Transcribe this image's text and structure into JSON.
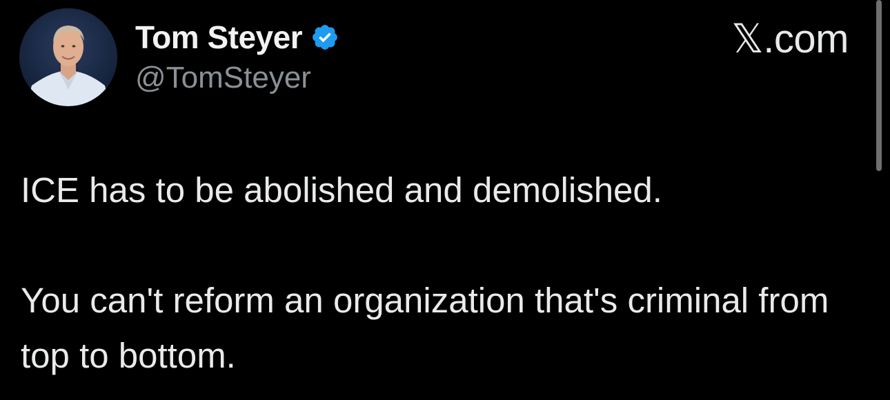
{
  "author": {
    "display_name": "Tom Steyer",
    "handle": "@TomSteyer",
    "verified_icon": "verified-badge-icon",
    "avatar_icon": "profile-photo"
  },
  "header": {
    "site_label": "𝕏.com"
  },
  "tweet": {
    "paragraphs": [
      "ICE has to be abolished and demolished.",
      "You can't reform an organization that's criminal from top to bottom."
    ]
  },
  "colors": {
    "background": "#000000",
    "text_primary": "#e7e9ea",
    "text_secondary": "#8b9096",
    "verified_blue": "#1d9bf0"
  }
}
